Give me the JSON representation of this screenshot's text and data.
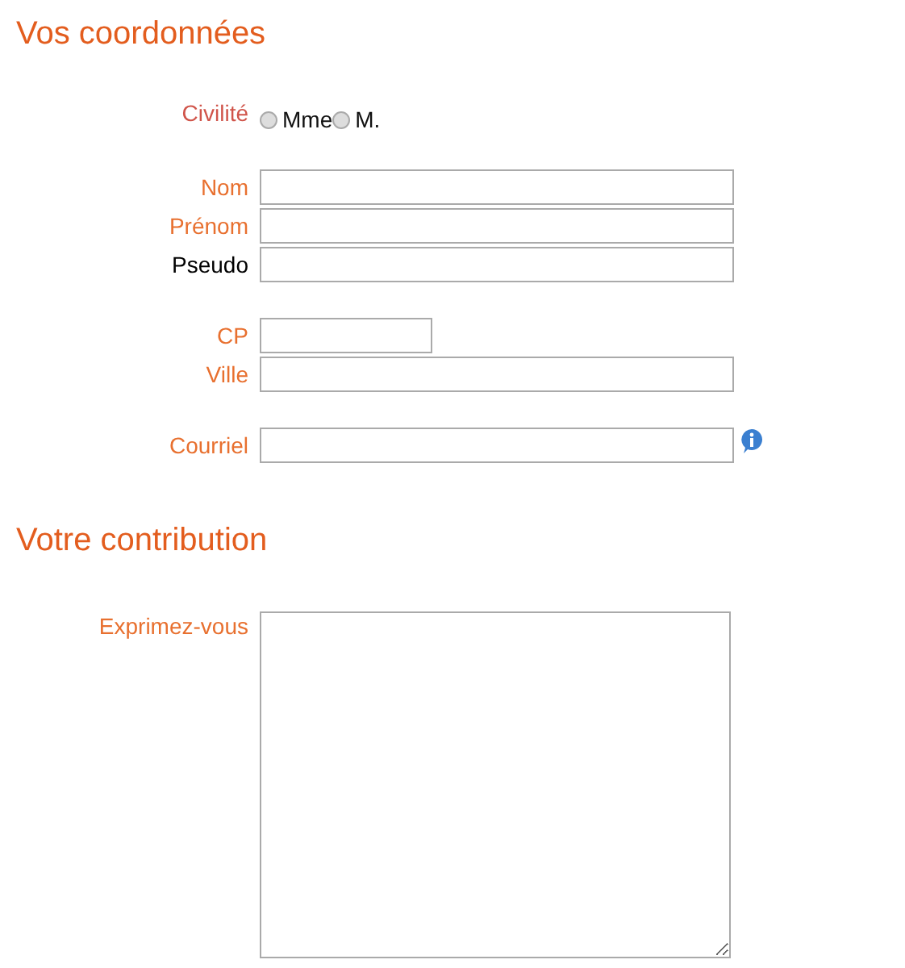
{
  "sections": [
    {
      "title": "Vos coordonnées",
      "groups": [
        [
          {
            "kind": "radio",
            "label": "Civilité",
            "required": true,
            "options": [
              {
                "label": "Mme",
                "selected": false
              },
              {
                "label": "M.",
                "selected": false
              }
            ]
          }
        ],
        [
          {
            "kind": "text",
            "label": "Nom",
            "required": true
          },
          {
            "kind": "text",
            "label": "Prénom",
            "required": true
          },
          {
            "kind": "text",
            "label": "Pseudo",
            "required": false
          }
        ],
        [
          {
            "kind": "short",
            "label": "CP",
            "required": true
          },
          {
            "kind": "text",
            "label": "Ville",
            "required": true
          }
        ],
        [
          {
            "kind": "text",
            "label": "Courriel",
            "required": true,
            "info": true
          }
        ]
      ]
    },
    {
      "title": "Votre contribution",
      "groups": [
        [
          {
            "kind": "textarea",
            "label": "Exprimez-vous",
            "required": true
          }
        ]
      ]
    }
  ]
}
